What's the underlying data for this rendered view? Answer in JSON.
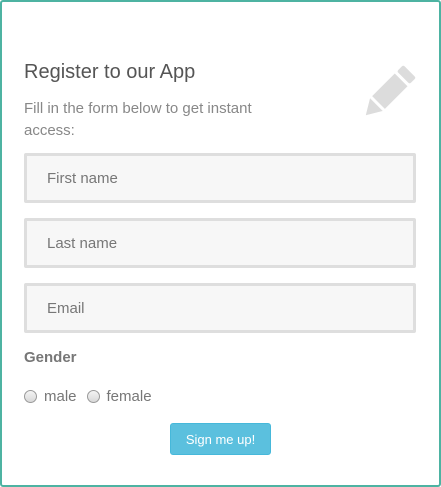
{
  "form": {
    "title": "Register to our App",
    "subtitle": "Fill in the form below to get instant access:",
    "icon": "pencil-icon",
    "fields": [
      {
        "placeholder": "First name",
        "value": ""
      },
      {
        "placeholder": "Last name",
        "value": ""
      },
      {
        "placeholder": "Email",
        "value": ""
      }
    ],
    "gender": {
      "label": "Gender",
      "options": [
        "male",
        "female"
      ]
    },
    "submit_label": "Sign me up!"
  },
  "colors": {
    "border_accent": "#4db3a2",
    "button": "#5bc0de"
  }
}
